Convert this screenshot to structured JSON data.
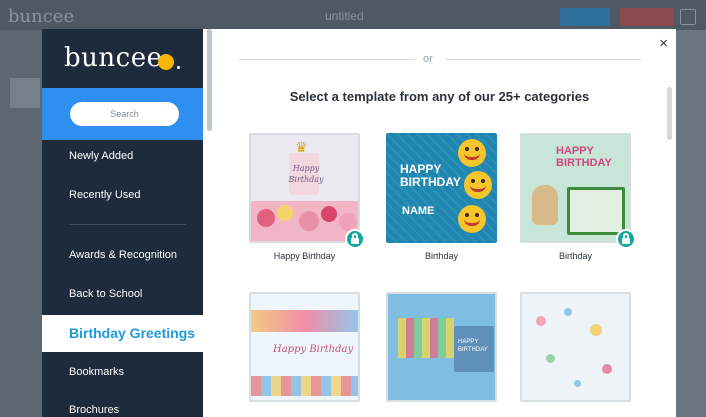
{
  "background": {
    "logo_text": "buncee",
    "title_text": "untitled"
  },
  "sidebar": {
    "logo": "buncee",
    "search_placeholder": "Search",
    "items": [
      {
        "label": "Newly Added"
      },
      {
        "label": "Recently Used"
      },
      {
        "label": "Awards & Recognition"
      },
      {
        "label": "Back to School"
      },
      {
        "label": "Birthday Greetings",
        "active": true
      },
      {
        "label": "Bookmarks"
      },
      {
        "label": "Brochures"
      }
    ]
  },
  "main": {
    "close_glyph": "×",
    "divider_text": "or",
    "heading": "Select a template from any of our 25+ categories",
    "cards": [
      {
        "label": "Happy Birthday",
        "locked": true,
        "art_text": "Happy Birthday"
      },
      {
        "label": "Birthday",
        "locked": false,
        "art_text": "HAPPY BIRTHDAY",
        "art_name": "NAME"
      },
      {
        "label": "Birthday",
        "locked": true,
        "art_text": "HAPPY BIRTHDAY"
      },
      {
        "label": "",
        "locked": false,
        "art_text": "Happy Birthday"
      },
      {
        "label": "",
        "locked": false,
        "art_text": "HAPPY BIRTHDAY"
      },
      {
        "label": "",
        "locked": false
      }
    ]
  },
  "colors": {
    "sidebar_bg": "#1d2b3c",
    "search_band": "#2f8ff0",
    "active_label": "#1f9ad8",
    "lock_badge": "#16a6a1",
    "logo_dot": "#f7b500"
  },
  "icons": {
    "lock": "lock-icon",
    "close": "close-icon"
  }
}
